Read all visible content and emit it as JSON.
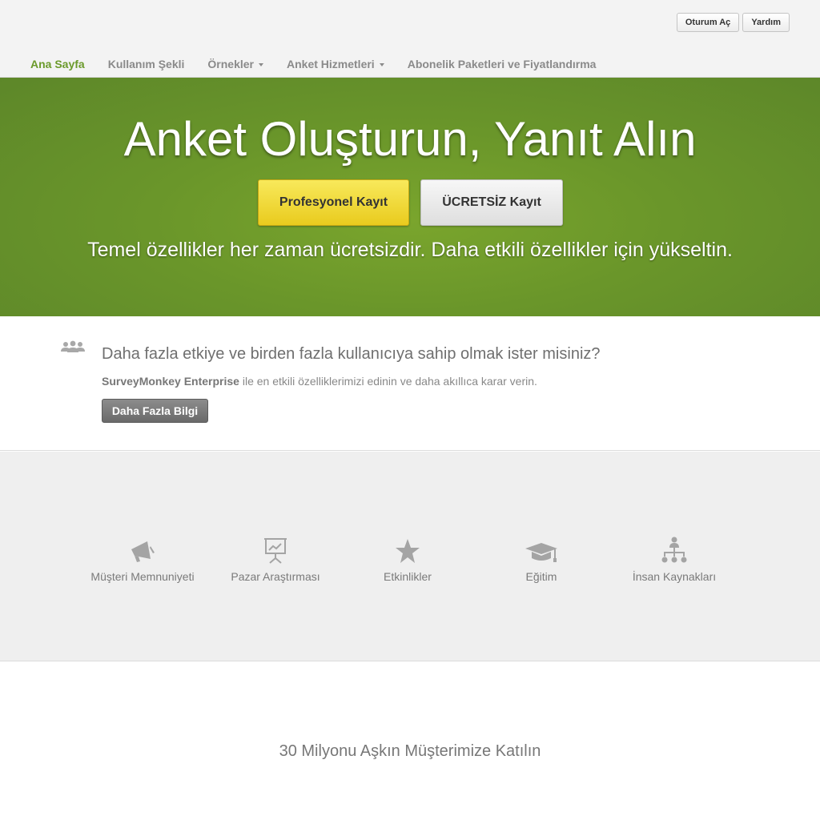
{
  "header": {
    "login_label": "Oturum Aç",
    "help_label": "Yardım",
    "nav": [
      {
        "label": "Ana Sayfa"
      },
      {
        "label": "Kullanım Şekli"
      },
      {
        "label": "Örnekler"
      },
      {
        "label": "Anket Hizmetleri"
      },
      {
        "label": "Abonelik Paketleri ve Fiyatlandırma"
      }
    ]
  },
  "hero": {
    "title": "Anket Oluşturun, Yanıt Alın",
    "pro_button": "Profesyonel Kayıt",
    "free_button": "ÜCRETSİZ Kayıt",
    "subtitle": "Temel özellikler her zaman ücretsizdir. Daha etkili özellikler için yükseltin."
  },
  "enterprise": {
    "title": "Daha fazla etkiye ve birden fazla kullanıcıya sahip olmak ister misiniz?",
    "brand": "SurveyMonkey Enterprise",
    "description": " ile en etkili özelliklerimizi edinin ve daha akıllıca karar verin.",
    "button": "Daha Fazla Bilgi"
  },
  "categories": [
    {
      "label": "Müşteri Memnuniyeti",
      "icon": "megaphone-icon"
    },
    {
      "label": "Pazar Araştırması",
      "icon": "presentation-chart-icon"
    },
    {
      "label": "Etkinlikler",
      "icon": "star-icon"
    },
    {
      "label": "Eğitim",
      "icon": "graduation-cap-icon"
    },
    {
      "label": "İnsan Kaynakları",
      "icon": "org-chart-icon"
    }
  ],
  "bottom": {
    "join_text": "30 Milyonu Aşkın Müşterimize Katılın"
  },
  "colors": {
    "accent_green": "#6b9a2b",
    "hero_green": "#6a962a",
    "pro_yellow": "#f0d93a"
  }
}
